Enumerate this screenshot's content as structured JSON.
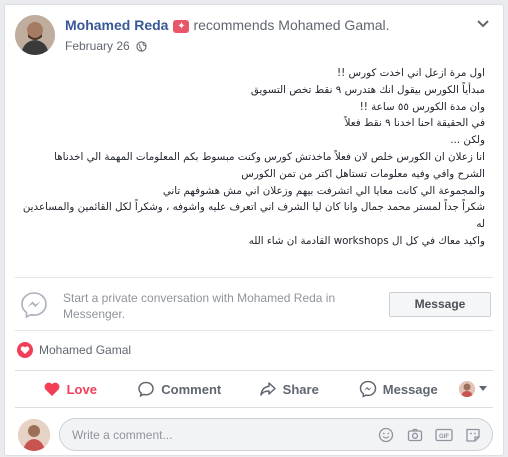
{
  "header": {
    "author": "Mohamed Reda",
    "recommends": "recommends",
    "target": "Mohamed Gamal.",
    "date": "February 26",
    "badge_glyph": "✦"
  },
  "post": {
    "lines": [
      "اول مرة ازعل اني اخدت كورس !!",
      "مبدأياً الكورس بيقول انك هتدرس ٩ نقط تخص التسويق",
      "وان مدة الكورس ٥٥ ساعة !!",
      "في الحقيقة احنا اخدنا ٩ نقط فعلاً",
      "ولكن ...",
      "انا زعلان ان الكورس خلص لان فعلاً ماخدتش كورس وكنت مبسوط بكم المعلومات المهمة الي اخدناها",
      "الشرح وافي وفيه معلومات تستاهل اكتر من تمن الكورس",
      "والمجموعة الي كانت معايا الي اتشرفت بيهم وزعلان اني مش هشوفهم تاني",
      "شكراً جداً لمستر محمد جمال وانا كان ليا الشرف اني اتعرف عليه واشوفه ، وشكراً لكل القائمين والمساعدين",
      "له",
      "واكيد معاك في كل ال workshops القادمة ان شاء الله"
    ]
  },
  "messenger": {
    "text": "Start a private conversation with Mohamed Reda in Messenger.",
    "button": "Message"
  },
  "reactions": {
    "name": "Mohamed Gamal"
  },
  "actions": {
    "love": "Love",
    "comment": "Comment",
    "share": "Share",
    "message": "Message"
  },
  "comment": {
    "placeholder": "Write a comment..."
  },
  "colors": {
    "link": "#385898",
    "love": "#f33e58",
    "muted": "#606770"
  }
}
